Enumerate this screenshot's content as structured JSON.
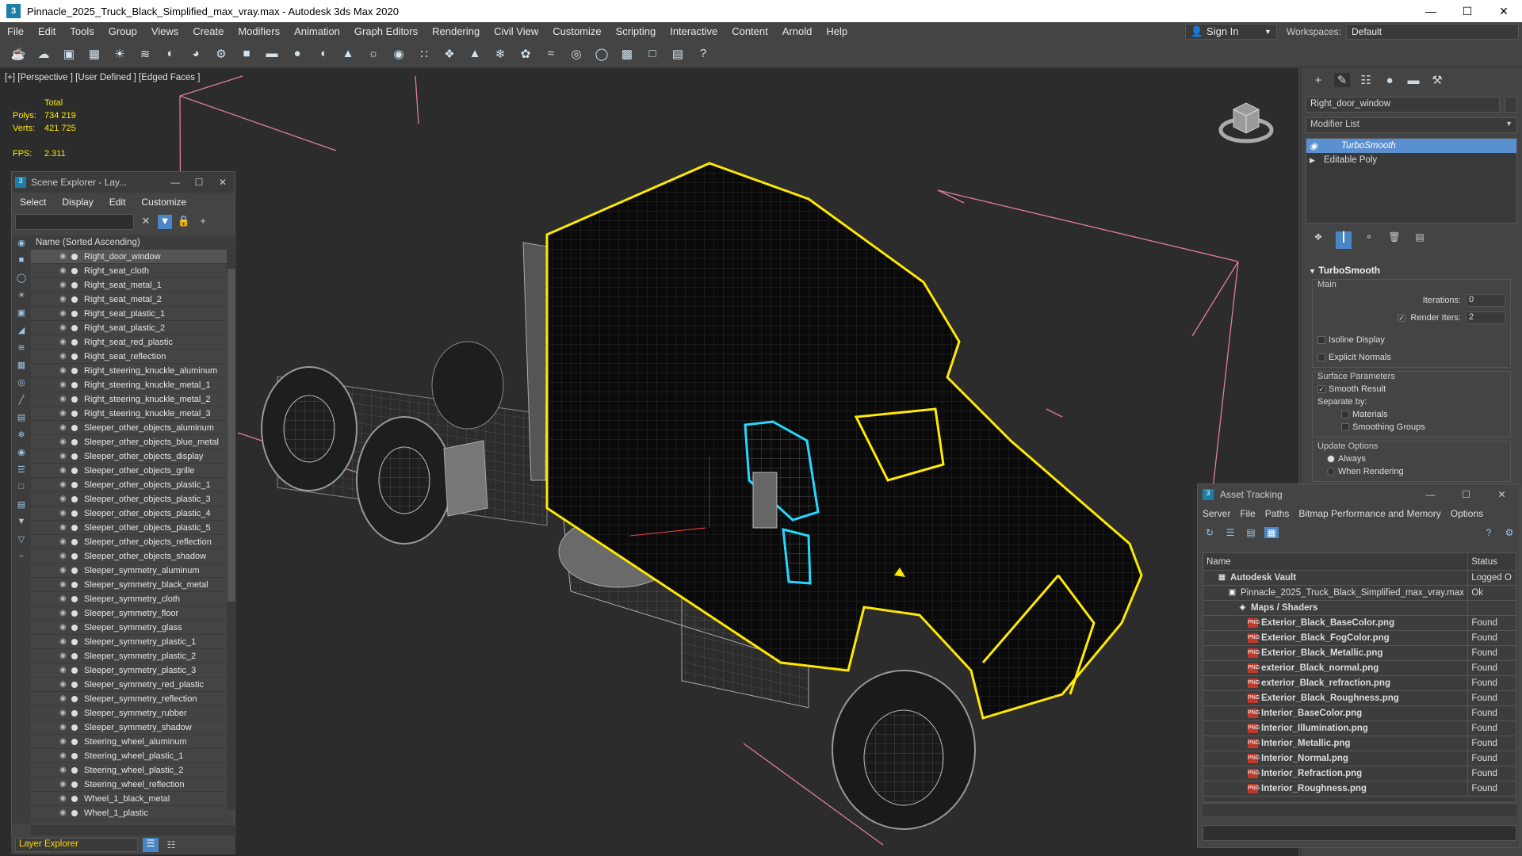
{
  "window": {
    "title": "Pinnacle_2025_Truck_Black_Simplified_max_vray.max - Autodesk 3ds Max 2020",
    "app_icon": "3"
  },
  "menu": [
    "File",
    "Edit",
    "Tools",
    "Group",
    "Views",
    "Create",
    "Modifiers",
    "Animation",
    "Graph Editors",
    "Rendering",
    "Civil View",
    "Customize",
    "Scripting",
    "Interactive",
    "Content",
    "Arnold",
    "Help"
  ],
  "signin": {
    "label": "Sign In"
  },
  "workspace": {
    "label": "Workspaces:",
    "value": "Default"
  },
  "viewport": {
    "label": "[+] [Perspective ] [User Defined ] [Edged Faces ]",
    "stats": {
      "total": "Total",
      "polys_label": "Polys:",
      "polys": "734 219",
      "verts_label": "Verts:",
      "verts": "421 725",
      "fps_label": "FPS:",
      "fps": "2.311"
    }
  },
  "scene_explorer": {
    "title": "Scene Explorer - Lay...",
    "menu": [
      "Select",
      "Display",
      "Edit",
      "Customize"
    ],
    "column": "Name (Sorted Ascending)",
    "rows": [
      "Right_door_window",
      "Right_seat_cloth",
      "Right_seat_metal_1",
      "Right_seat_metal_2",
      "Right_seat_plastic_1",
      "Right_seat_plastic_2",
      "Right_seat_red_plastic",
      "Right_seat_reflection",
      "Right_steering_knuckle_aluminum",
      "Right_steering_knuckle_metal_1",
      "Right_steering_knuckle_metal_2",
      "Right_steering_knuckle_metal_3",
      "Sleeper_other_objects_aluminum",
      "Sleeper_other_objects_blue_metal",
      "Sleeper_other_objects_display",
      "Sleeper_other_objects_grille",
      "Sleeper_other_objects_plastic_1",
      "Sleeper_other_objects_plastic_3",
      "Sleeper_other_objects_plastic_4",
      "Sleeper_other_objects_plastic_5",
      "Sleeper_other_objects_reflection",
      "Sleeper_other_objects_shadow",
      "Sleeper_symmetry_aluminum",
      "Sleeper_symmetry_black_metal",
      "Sleeper_symmetry_cloth",
      "Sleeper_symmetry_floor",
      "Sleeper_symmetry_glass",
      "Sleeper_symmetry_plastic_1",
      "Sleeper_symmetry_plastic_2",
      "Sleeper_symmetry_plastic_3",
      "Sleeper_symmetry_red_plastic",
      "Sleeper_symmetry_reflection",
      "Sleeper_symmetry_rubber",
      "Sleeper_symmetry_shadow",
      "Steering_wheel_aluminum",
      "Steering_wheel_plastic_1",
      "Steering_wheel_plastic_2",
      "Steering_wheel_reflection",
      "Wheel_1_black_metal",
      "Wheel_1_plastic"
    ],
    "footer": "Layer Explorer"
  },
  "command_panel": {
    "object_name": "Right_door_window",
    "modifier_list": "Modifier List",
    "stack": [
      "TurboSmooth",
      "Editable Poly"
    ],
    "rollout": "TurboSmooth",
    "main": "Main",
    "iterations_label": "Iterations:",
    "iterations": "0",
    "render_iters_label": "Render Iters:",
    "render_iters": "2",
    "isoline": "Isoline Display",
    "explicit": "Explicit Normals",
    "surface": "Surface Parameters",
    "smooth_result": "Smooth Result",
    "separate": "Separate by:",
    "materials": "Materials",
    "smoothing_groups": "Smoothing Groups",
    "update": "Update Options",
    "always": "Always",
    "when_rendering": "When Rendering"
  },
  "asset_tracking": {
    "title": "Asset Tracking",
    "menu": [
      "Server",
      "File",
      "Paths",
      "Bitmap Performance and Memory",
      "Options"
    ],
    "col_name": "Name",
    "col_status": "Status",
    "rows": [
      {
        "indent": 1,
        "icon": "vault",
        "name": "Autodesk Vault",
        "status": "Logged O"
      },
      {
        "indent": 2,
        "icon": "max",
        "name": "Pinnacle_2025_Truck_Black_Simplified_max_vray.max",
        "status": "Ok"
      },
      {
        "indent": 3,
        "icon": "maps",
        "name": "Maps / Shaders",
        "status": ""
      },
      {
        "indent": 4,
        "icon": "png",
        "name": "Exterior_Black_BaseColor.png",
        "status": "Found"
      },
      {
        "indent": 4,
        "icon": "png",
        "name": "Exterior_Black_FogColor.png",
        "status": "Found"
      },
      {
        "indent": 4,
        "icon": "png",
        "name": "Exterior_Black_Metallic.png",
        "status": "Found"
      },
      {
        "indent": 4,
        "icon": "png",
        "name": "exterior_Black_normal.png",
        "status": "Found"
      },
      {
        "indent": 4,
        "icon": "png",
        "name": "exterior_Black_refraction.png",
        "status": "Found"
      },
      {
        "indent": 4,
        "icon": "png",
        "name": "Exterior_Black_Roughness.png",
        "status": "Found"
      },
      {
        "indent": 4,
        "icon": "png",
        "name": "Interior_BaseColor.png",
        "status": "Found"
      },
      {
        "indent": 4,
        "icon": "png",
        "name": "Interior_Illumination.png",
        "status": "Found"
      },
      {
        "indent": 4,
        "icon": "png",
        "name": "Interior_Metallic.png",
        "status": "Found"
      },
      {
        "indent": 4,
        "icon": "png",
        "name": "Interior_Normal.png",
        "status": "Found"
      },
      {
        "indent": 4,
        "icon": "png",
        "name": "Interior_Refraction.png",
        "status": "Found"
      },
      {
        "indent": 4,
        "icon": "png",
        "name": "Interior_Roughness.png",
        "status": "Found"
      }
    ]
  },
  "colors": {
    "accent": "#4a86c5",
    "selection_yellow": "#ffea00",
    "highlight_cyan": "#26d7ff",
    "grid_pink": "#e07ca0"
  }
}
